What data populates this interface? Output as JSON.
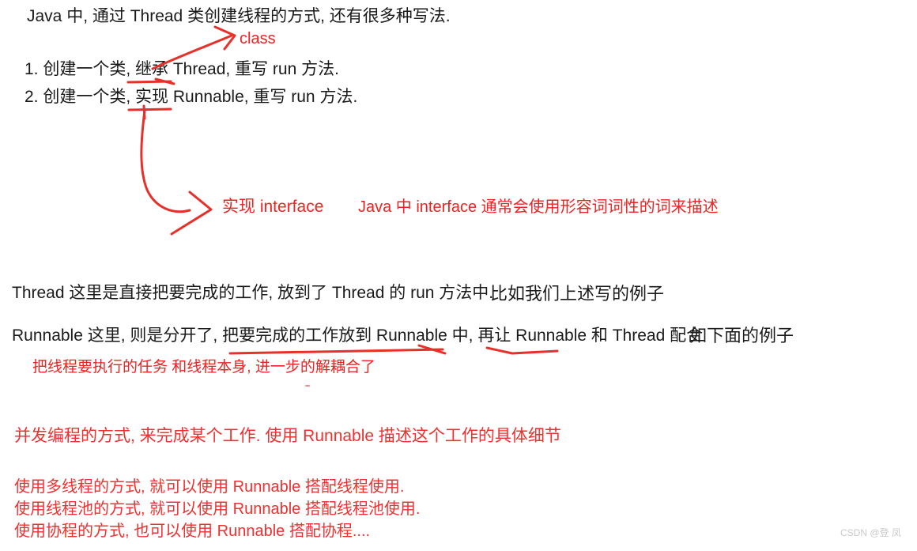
{
  "document": {
    "intro": "Java 中, 通过 Thread 类创建线程的方式, 还有很多种写法.",
    "list": [
      "1. 创建一个类, 继承 Thread, 重写 run 方法.",
      "2. 创建一个类, 实现 Runnable, 重写 run 方法."
    ],
    "body": {
      "thread_line": "Thread 这里是直接把要完成的工作, 放到了 Thread 的 run 方法中.",
      "thread_note": "比如我们上述写的例子",
      "runnable_line": "Runnable 这里, 则是分开了, 把要完成的工作放到 Runnable 中, 再让 Runnable 和 Thread 配合",
      "runnable_note": "如下面的例子"
    }
  },
  "annotations": {
    "class_label": "class",
    "interface_label": "实现 interface",
    "interface_desc": "Java 中 interface 通常会使用形容词词性的词来描述",
    "decouple_note": "把线程要执行的任务 和线程本身, 进一步的解耦合了",
    "summary": "并发编程的方式, 来完成某个工作. 使用 Runnable 描述这个工作的具体细节",
    "usages": [
      "使用多线程的方式, 就可以使用 Runnable 搭配线程使用.",
      "使用线程池的方式, 就可以使用 Runnable 搭配线程池使用.",
      "使用协程的方式, 也可以使用 Runnable 搭配协程...."
    ]
  },
  "watermark": {
    "text": "CSDN @登 凤"
  },
  "colors": {
    "ink": "#1a1a1a",
    "annotation_red": "#e8302a",
    "bright_red": "#ee2222",
    "summary_red": "#f03030",
    "watermark_gray": "#c9c9c9",
    "page_background": "#ffffff"
  }
}
